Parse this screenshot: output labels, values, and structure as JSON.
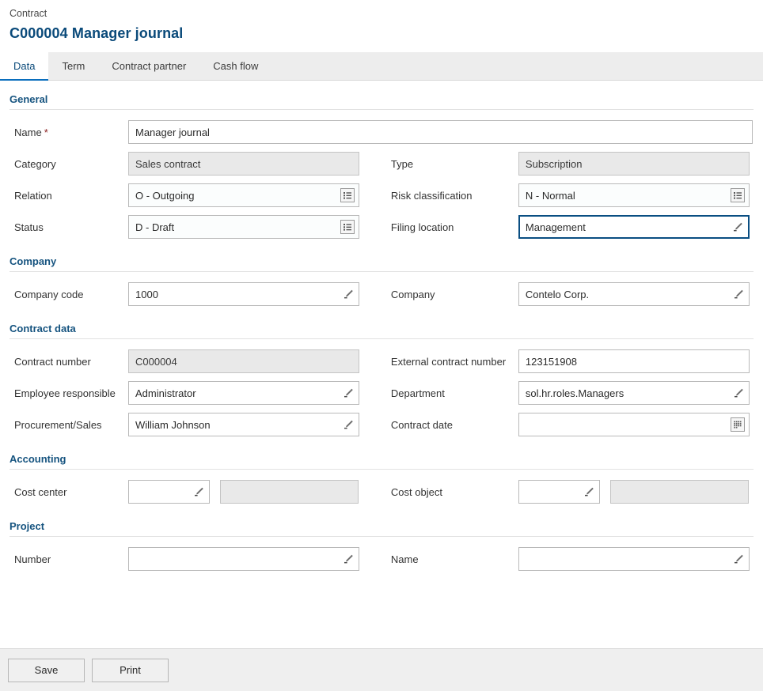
{
  "header": {
    "breadcrumb": "Contract",
    "title": "C000004 Manager journal"
  },
  "tabs": [
    {
      "label": "Data",
      "active": true
    },
    {
      "label": "Term",
      "active": false
    },
    {
      "label": "Contract partner",
      "active": false
    },
    {
      "label": "Cash flow",
      "active": false
    }
  ],
  "sections": {
    "general": {
      "title": "General",
      "name": {
        "label": "Name",
        "required": true,
        "value": "Manager journal"
      },
      "category": {
        "label": "Category",
        "value": "Sales contract"
      },
      "type": {
        "label": "Type",
        "value": "Subscription"
      },
      "relation": {
        "label": "Relation",
        "value": "O - Outgoing",
        "icon": "list-picker-icon"
      },
      "risk_classification": {
        "label": "Risk classification",
        "value": "N - Normal",
        "icon": "list-picker-icon"
      },
      "status": {
        "label": "Status",
        "value": "D - Draft",
        "icon": "list-picker-icon"
      },
      "filing_location": {
        "label": "Filing location",
        "value": "Management",
        "icon": "pencil-icon",
        "focused": true
      }
    },
    "company": {
      "title": "Company",
      "company_code": {
        "label": "Company code",
        "value": "1000",
        "icon": "pencil-icon"
      },
      "company": {
        "label": "Company",
        "value": "Contelo Corp.",
        "icon": "pencil-icon"
      }
    },
    "contract_data": {
      "title": "Contract data",
      "contract_number": {
        "label": "Contract number",
        "value": "C000004"
      },
      "external_contract_number": {
        "label": "External contract number",
        "value": "123151908"
      },
      "employee_responsible": {
        "label": "Employee responsible",
        "value": "Administrator",
        "icon": "pencil-icon"
      },
      "department": {
        "label": "Department",
        "value": "sol.hr.roles.Managers",
        "icon": "pencil-icon"
      },
      "procurement_sales": {
        "label": "Procurement/Sales",
        "value": "William Johnson",
        "icon": "pencil-icon"
      },
      "contract_date": {
        "label": "Contract date",
        "value": "",
        "icon": "calendar-icon"
      }
    },
    "accounting": {
      "title": "Accounting",
      "cost_center": {
        "label": "Cost center",
        "value": "",
        "description": "",
        "icon": "pencil-icon"
      },
      "cost_object": {
        "label": "Cost object",
        "value": "",
        "description": "",
        "icon": "pencil-icon"
      }
    },
    "project": {
      "title": "Project",
      "number": {
        "label": "Number",
        "value": "",
        "icon": "pencil-icon"
      },
      "name": {
        "label": "Name",
        "value": "",
        "icon": "pencil-icon"
      }
    }
  },
  "footer": {
    "save_label": "Save",
    "print_label": "Print"
  },
  "colors": {
    "accent": "#0a4a7a",
    "tab_active_underline": "#0a6ebd",
    "focus_border": "#0a4e82",
    "section_heading": "#15537f",
    "required_asterisk": "#8a2020",
    "disabled_bg": "#e9e9e9",
    "tabbar_bg": "#ededed",
    "footer_bg": "#efefef"
  }
}
